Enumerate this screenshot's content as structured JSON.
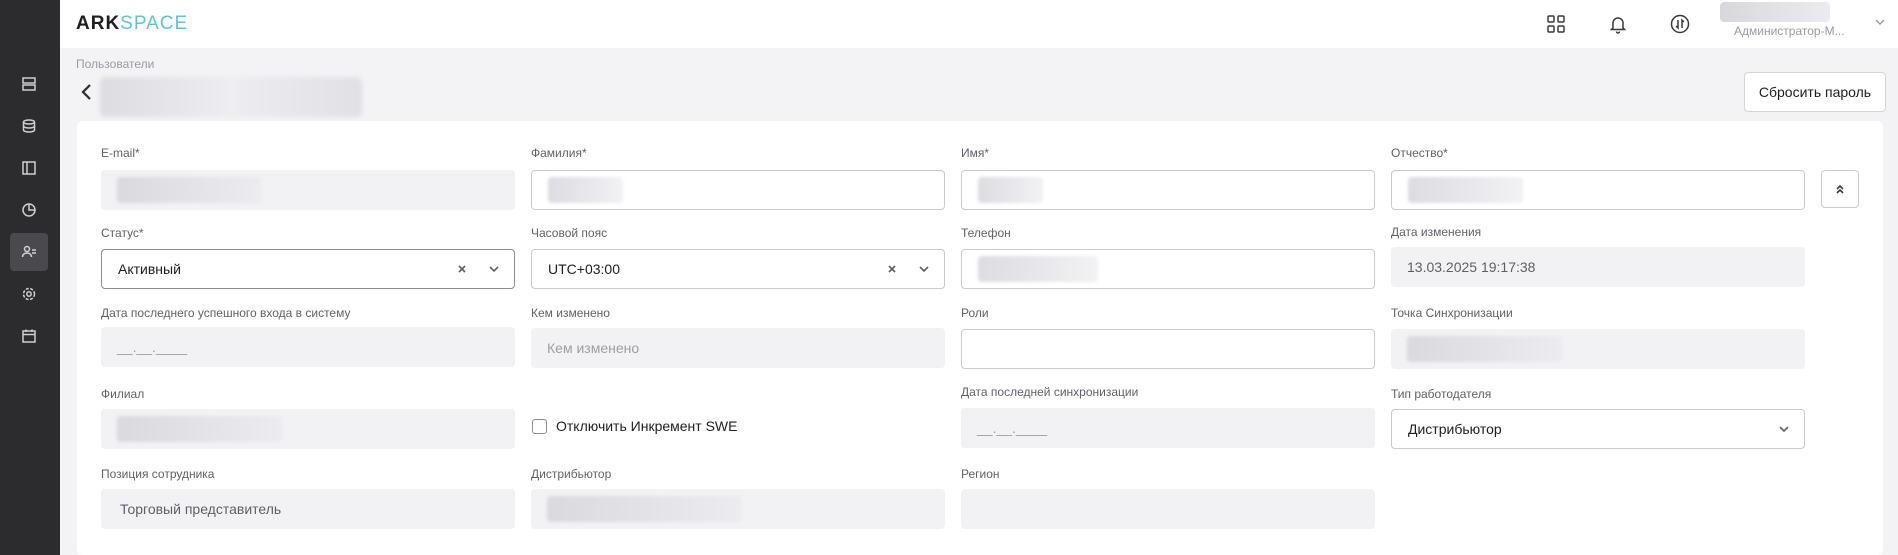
{
  "app": {
    "logo_left": "ARK",
    "logo_right": "SPACE"
  },
  "topbar": {
    "user_role": "Администратор-М...",
    "icons": [
      "apps-grid-icon",
      "bell-icon",
      "sync-icon"
    ]
  },
  "breadcrumb": "Пользователи",
  "actions": {
    "reset_password": "Сбросить пароль"
  },
  "sidebar": {
    "icons": [
      "servers-icon",
      "database-icon",
      "layout-icon",
      "chart-pie-icon",
      "users-icon",
      "settings-icon",
      "calendar-icon"
    ],
    "active": "users-icon"
  },
  "form": {
    "email_label": "E-mail*",
    "lastname_label": "Фамилия*",
    "firstname_label": "Имя*",
    "middlename_label": "Отчество*",
    "status_label": "Статус*",
    "status_value": "Активный",
    "timezone_label": "Часовой пояс",
    "timezone_value": "UTC+03:00",
    "phone_label": "Телефон",
    "modified_date_label": "Дата изменения",
    "modified_date_value": "13.03.2025 19:17:38",
    "last_login_label": "Дата последнего успешного входа в систему",
    "last_login_value": "__.__.____",
    "modified_by_label": "Кем изменено",
    "modified_by_placeholder": "Кем изменено",
    "roles_label": "Роли",
    "sync_point_label": "Точка Синхронизации",
    "branch_label": "Филиал",
    "disable_increment_label": "Отключить Инкремент SWE",
    "last_sync_label": "Дата последней синхронизации",
    "last_sync_value": "__.__.____",
    "employer_type_label": "Тип работодателя",
    "employer_type_value": "Дистрибьютор",
    "position_label": "Позиция сотрудника",
    "position_value": "Торговый представитель",
    "distributor_label": "Дистрибьютор",
    "region_label": "Регион"
  }
}
